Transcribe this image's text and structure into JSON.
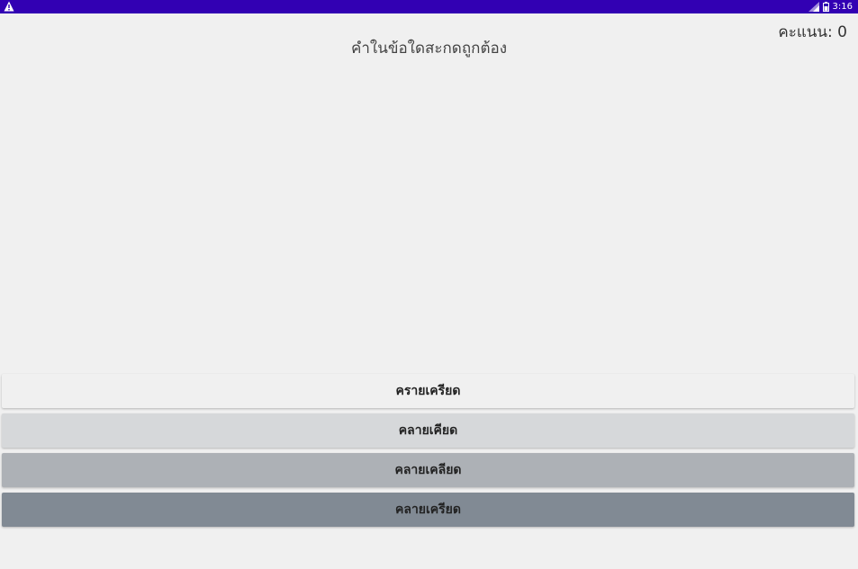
{
  "status_bar": {
    "time": "3:16",
    "warning_icon": "warning-triangle-icon",
    "signal_icon": "signal-icon",
    "battery_icon": "battery-icon",
    "color": "#3200b3"
  },
  "score": {
    "text": "คะแนน: 0"
  },
  "question": {
    "text": "คำในข้อใดสะกดถูกต้อง"
  },
  "answers": [
    {
      "label": "ครายเครียด",
      "color": "#f0f0f0"
    },
    {
      "label": "คลายเคียด",
      "color": "#d6d8da"
    },
    {
      "label": "คลายเคลียด",
      "color": "#adb1b6"
    },
    {
      "label": "คลายเครียด",
      "color": "#818a94"
    }
  ]
}
